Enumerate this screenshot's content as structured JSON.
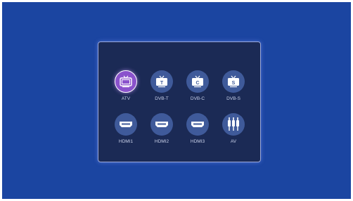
{
  "sources": [
    {
      "label": "ATV",
      "icon": "tv-icon",
      "letter": "",
      "selected": true
    },
    {
      "label": "DVB-T",
      "icon": "tv-icon",
      "letter": "T",
      "selected": false
    },
    {
      "label": "DVB-C",
      "icon": "tv-icon",
      "letter": "C",
      "selected": false
    },
    {
      "label": "DVB-S",
      "icon": "tv-icon",
      "letter": "S",
      "selected": false
    },
    {
      "label": "HDMI1",
      "icon": "hdmi-port-icon",
      "letter": "",
      "selected": false
    },
    {
      "label": "HDMI2",
      "icon": "hdmi-port-icon",
      "letter": "",
      "selected": false
    },
    {
      "label": "HDMI3",
      "icon": "hdmi-port-icon",
      "letter": "",
      "selected": false
    },
    {
      "label": "AV",
      "icon": "av-plug-icon",
      "letter": "",
      "selected": false
    }
  ],
  "colors": {
    "background": "#1b45a1",
    "dialog": "#1b2a55",
    "icon_circle": "#3f5a9a",
    "selected_circle": "#8a52cc"
  }
}
